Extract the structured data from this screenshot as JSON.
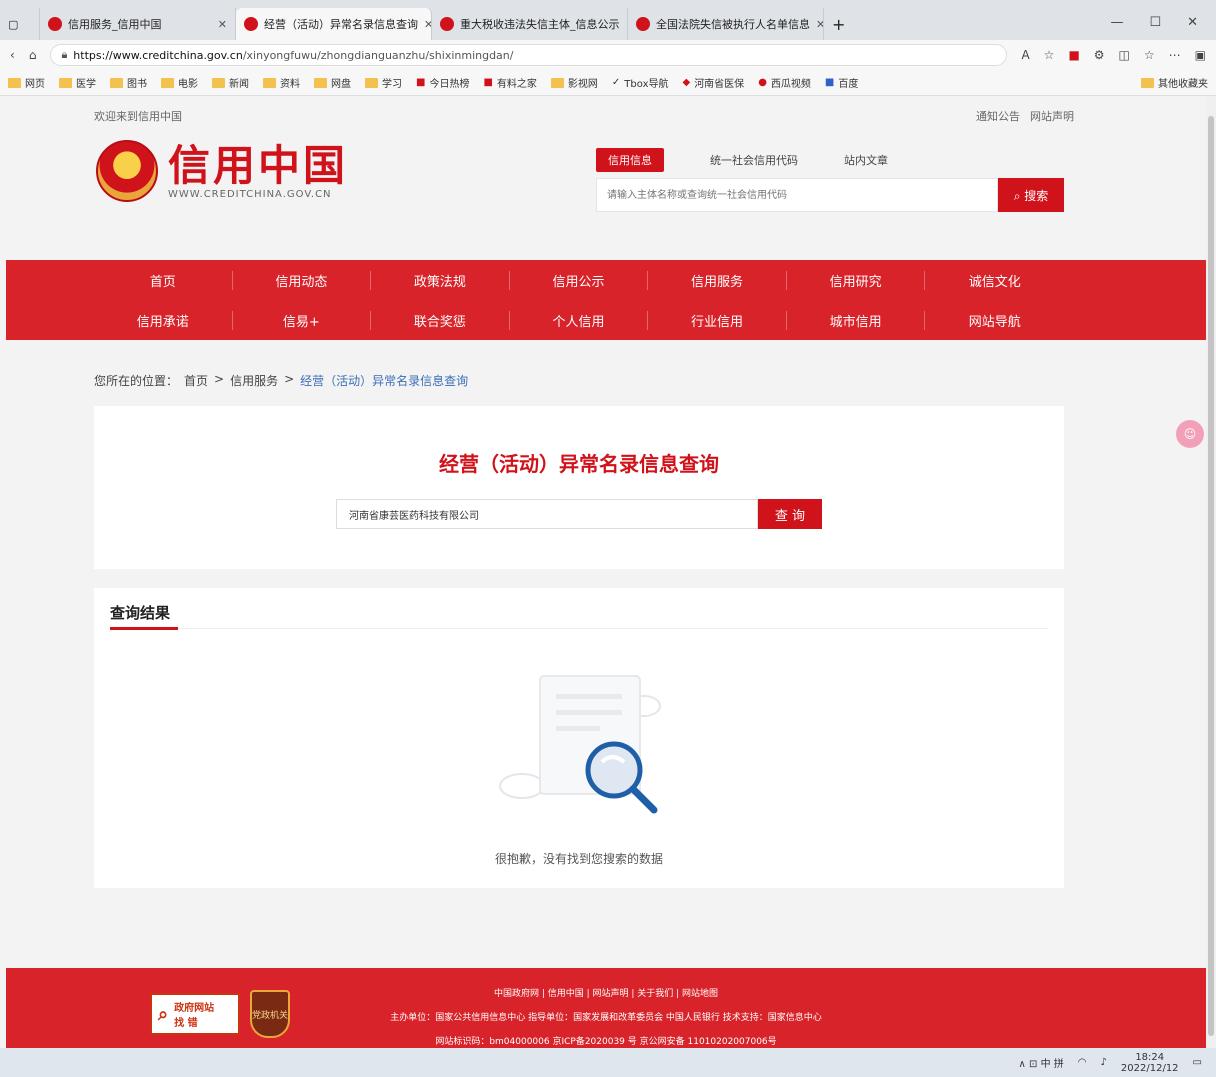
{
  "browser": {
    "tabs": [
      {
        "label": "信用服务_信用中国",
        "active": false
      },
      {
        "label": "经营（活动）异常名录信息查询",
        "active": true
      },
      {
        "label": "重大税收违法失信主体_信息公示",
        "active": false
      },
      {
        "label": "全国法院失信被执行人名单信息",
        "active": false
      }
    ],
    "new_tab": "+",
    "window_controls": [
      "—",
      "☐",
      "✕"
    ],
    "url_host": "https://www.creditchina.gov.cn",
    "url_path": "/xinyongfuwu/zhongdianguanzhu/shixinmingdan/",
    "bookmarks": [
      "网页",
      "医学",
      "图书",
      "电影",
      "新闻",
      "资料",
      "网盘",
      "学习",
      "今日热榜",
      "有料之家",
      "影视网",
      "Tbox导航",
      "河南省医保",
      "西瓜视频",
      "百度"
    ],
    "other_bookmarks": "其他收藏夹"
  },
  "site": {
    "welcome": "欢迎来到信用中国",
    "top_links": [
      "通知公告",
      "网站声明"
    ],
    "logo_cn": "信用中国",
    "logo_en": "WWW.CREDITCHINA.GOV.CN",
    "search_tabs": [
      "信用信息",
      "统一社会信用代码",
      "站内文章"
    ],
    "search_placeholder": "请输入主体名称或查询统一社会信用代码",
    "search_button": "搜索",
    "nav_row1": [
      "首页",
      "信用动态",
      "政策法规",
      "信用公示",
      "信用服务",
      "信用研究",
      "诚信文化"
    ],
    "nav_row2": [
      "信用承诺",
      "信易+",
      "联合奖惩",
      "个人信用",
      "行业信用",
      "城市信用",
      "网站导航"
    ]
  },
  "breadcrumb": {
    "prefix": "您所在的位置：",
    "home": "首页",
    "sep": ">",
    "section": "信用服务",
    "current": "经营（活动）异常名录信息查询"
  },
  "query": {
    "title": "经营（活动）异常名录信息查询",
    "input_value": "河南省康芸医药科技有限公司",
    "button": "查 询"
  },
  "results": {
    "heading": "查询结果",
    "empty_message": "很抱歉，没有找到您搜索的数据"
  },
  "footer": {
    "links": "中国政府网 | 信用中国 | 网站声明 | 关于我们 | 网站地图",
    "sponsor": "主办单位：国家公共信用信息中心 指导单位：国家发展和改革委员会 中国人民银行 技术支持：国家信息中心",
    "icp": "网站标识码：bm04000006 京ICP备2020039 号 京公网安备 11010202007006号",
    "gov_badge_line1": "政府网站",
    "gov_badge_line2": "找 错",
    "police_badge": "党政机关"
  },
  "taskbar": {
    "tray": "∧ ⊡ 中 拼",
    "time": "18:24",
    "date": "2022/12/12"
  }
}
